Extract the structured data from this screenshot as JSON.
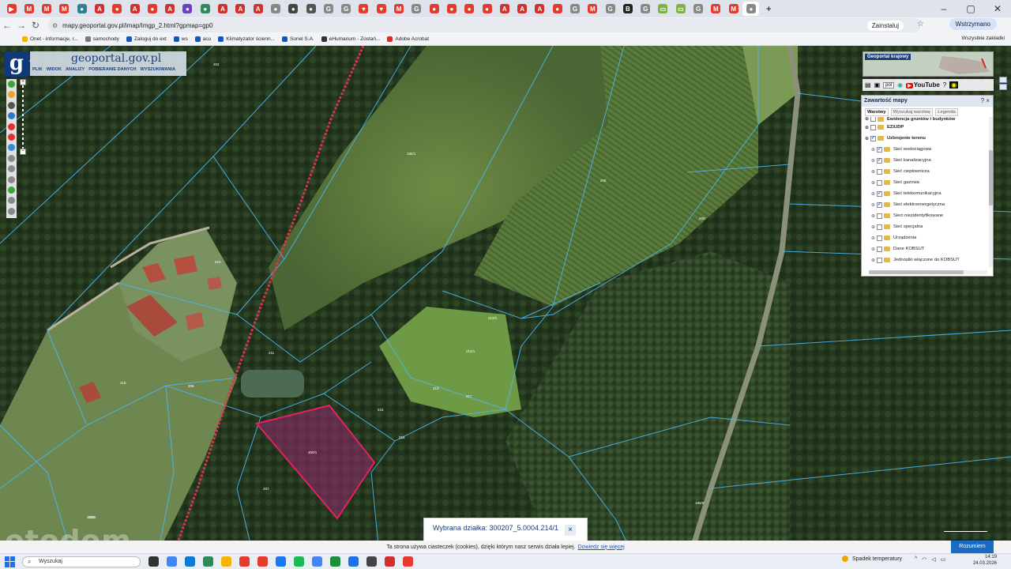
{
  "browser": {
    "tabs": [
      {
        "color": "#e33b2e",
        "glyph": "▶"
      },
      {
        "color": "#e33b2e",
        "glyph": "M"
      },
      {
        "color": "#e33b2e",
        "glyph": "M"
      },
      {
        "color": "#e33b2e",
        "glyph": "M"
      },
      {
        "color": "#2f7f8f",
        "glyph": "●"
      },
      {
        "color": "#d32f2f",
        "glyph": "A"
      },
      {
        "color": "#e33b2e",
        "glyph": "●"
      },
      {
        "color": "#d32f2f",
        "glyph": "A"
      },
      {
        "color": "#e33b2e",
        "glyph": "●"
      },
      {
        "color": "#d32f2f",
        "glyph": "A"
      },
      {
        "color": "#6d3fc6",
        "glyph": "●"
      },
      {
        "color": "#2e8b57",
        "glyph": "●"
      },
      {
        "color": "#d32f2f",
        "glyph": "A"
      },
      {
        "color": "#d32f2f",
        "glyph": "A"
      },
      {
        "color": "#d32f2f",
        "glyph": "A"
      },
      {
        "color": "#888",
        "glyph": "●"
      },
      {
        "color": "#444",
        "glyph": "●"
      },
      {
        "color": "#555",
        "glyph": "●"
      },
      {
        "color": "#888",
        "glyph": "G"
      },
      {
        "color": "#888",
        "glyph": "G"
      },
      {
        "color": "#e33b2e",
        "glyph": "♥"
      },
      {
        "color": "#e33b2e",
        "glyph": "♥"
      },
      {
        "color": "#e33b2e",
        "glyph": "M"
      },
      {
        "color": "#888",
        "glyph": "G"
      },
      {
        "color": "#e33b2e",
        "glyph": "●"
      },
      {
        "color": "#e33b2e",
        "glyph": "●"
      },
      {
        "color": "#e33b2e",
        "glyph": "●"
      },
      {
        "color": "#e33b2e",
        "glyph": "●"
      },
      {
        "color": "#d32f2f",
        "glyph": "A"
      },
      {
        "color": "#d32f2f",
        "glyph": "A"
      },
      {
        "color": "#d32f2f",
        "glyph": "A"
      },
      {
        "color": "#e33b2e",
        "glyph": "●"
      },
      {
        "color": "#888",
        "glyph": "G"
      },
      {
        "color": "#e33b2e",
        "glyph": "M"
      },
      {
        "color": "#888",
        "glyph": "G"
      },
      {
        "color": "#222",
        "glyph": "B"
      },
      {
        "color": "#888",
        "glyph": "G"
      },
      {
        "color": "#7cb342",
        "glyph": "▭"
      },
      {
        "color": "#7cb342",
        "glyph": "▭"
      },
      {
        "color": "#888",
        "glyph": "G"
      },
      {
        "color": "#e33b2e",
        "glyph": "M"
      },
      {
        "color": "#e33b2e",
        "glyph": "M"
      },
      {
        "color": "#888",
        "glyph": "●",
        "active": true
      }
    ],
    "new_tab": "+",
    "url": "mapy.geoportal.gov.pl/imap/Imgp_2.html?gpmap=gp0",
    "install_label": "Zainstaluj",
    "profile_label": "Wstrzymano",
    "bookmarks": [
      {
        "label": "Onet - informacje, r...",
        "color": "#f4b400"
      },
      {
        "label": "samochody",
        "color": "#7a7a7a"
      },
      {
        "label": "Zaloguj do ext",
        "color": "#1a56b8"
      },
      {
        "label": "ws",
        "color": "#1a56b8"
      },
      {
        "label": "acu",
        "color": "#1a56b8"
      },
      {
        "label": "Klimatyzator ścienn...",
        "color": "#1a56b8"
      },
      {
        "label": "Sonel S.A.",
        "color": "#1a56b8"
      },
      {
        "label": "eHumanum - Zostań...",
        "color": "#333"
      },
      {
        "label": "Adobe Acrobat",
        "color": "#d32f2f"
      }
    ],
    "all_bookmarks": "Wszystkie zakładki"
  },
  "geoportal": {
    "brand": "geoportal.gov.pl",
    "menu": [
      "PLIK",
      "WIDOK",
      "ANALIZY",
      "POBIERANIE DANYCH",
      "WYSZUKIWANIA"
    ],
    "tool_colors": [
      "#3aa33a",
      "#f0a030",
      "#555",
      "#2a7bd0",
      "#d33",
      "#e03030",
      "#3a8ad8",
      "#888",
      "#888",
      "#888",
      "#3aa33a",
      "#888",
      "#888"
    ],
    "zoom_in": "+",
    "zoom_out": "−",
    "overview_label": "Geoportal krajowy",
    "lang": "pol",
    "youtube": "YouTube",
    "panel": {
      "title": "Zawartość mapy",
      "tabs": [
        "Warstwy",
        "Wyszukaj warstwę",
        "Legenda"
      ],
      "layers": [
        {
          "name": "Ewidencja gruntów i budynków",
          "head": true,
          "checked": false,
          "cut": true
        },
        {
          "name": "EZiUDP",
          "head": true,
          "checked": false
        },
        {
          "name": "Uzbrojenie terenu",
          "head": true,
          "checked": true
        },
        {
          "name": "Sieć wodociągowa",
          "checked": true
        },
        {
          "name": "Sieć kanalizacyjna",
          "checked": true
        },
        {
          "name": "Sieć ciepłownicza",
          "checked": false
        },
        {
          "name": "Sieć gazowa",
          "checked": false
        },
        {
          "name": "Sieć telekomunikacyjna",
          "checked": true
        },
        {
          "name": "Sieć elektroenergetyczna",
          "checked": true
        },
        {
          "name": "Sieci niezidentyfikowane",
          "checked": false
        },
        {
          "name": "Sieć specjalna",
          "checked": false
        },
        {
          "name": "Urządzenia",
          "checked": false
        },
        {
          "name": "Dane KOBSUT",
          "checked": false
        },
        {
          "name": "Jednostki włączone do KOBSUT",
          "checked": false
        }
      ]
    },
    "parcel_labels": [
      "300/1",
      "300/2",
      "212/1",
      "185/1",
      "214/1",
      "211",
      "213",
      "217",
      "215",
      "216",
      "218",
      "210",
      "209",
      "208",
      "207",
      "206",
      "203",
      "202",
      "216/1",
      "185/5"
    ],
    "selection_label": "Wybrana działka: 300207_5.0004.214/1",
    "close": "×"
  },
  "cookie": {
    "text": "Ta strona używa ciasteczek (cookies), dzięki którym nasz serwis działa lepiej.",
    "link": "Dowiedz się więcej",
    "button": "Rozumiem"
  },
  "watermark": "otodom",
  "taskbar": {
    "search": "Wyszukaj",
    "apps": [
      "#333",
      "#4285f4",
      "#0a7ad6",
      "#2e8b57",
      "#f4b400",
      "#e33b2e",
      "#e33b2e",
      "#1877f2",
      "#1db954",
      "#4285f4",
      "#1e8e3e",
      "#1a73e8",
      "#444",
      "#d32f2f",
      "#e33b2e"
    ],
    "weather": "Spadek temperatury",
    "time": "14:19",
    "date": "24.03.2026"
  }
}
